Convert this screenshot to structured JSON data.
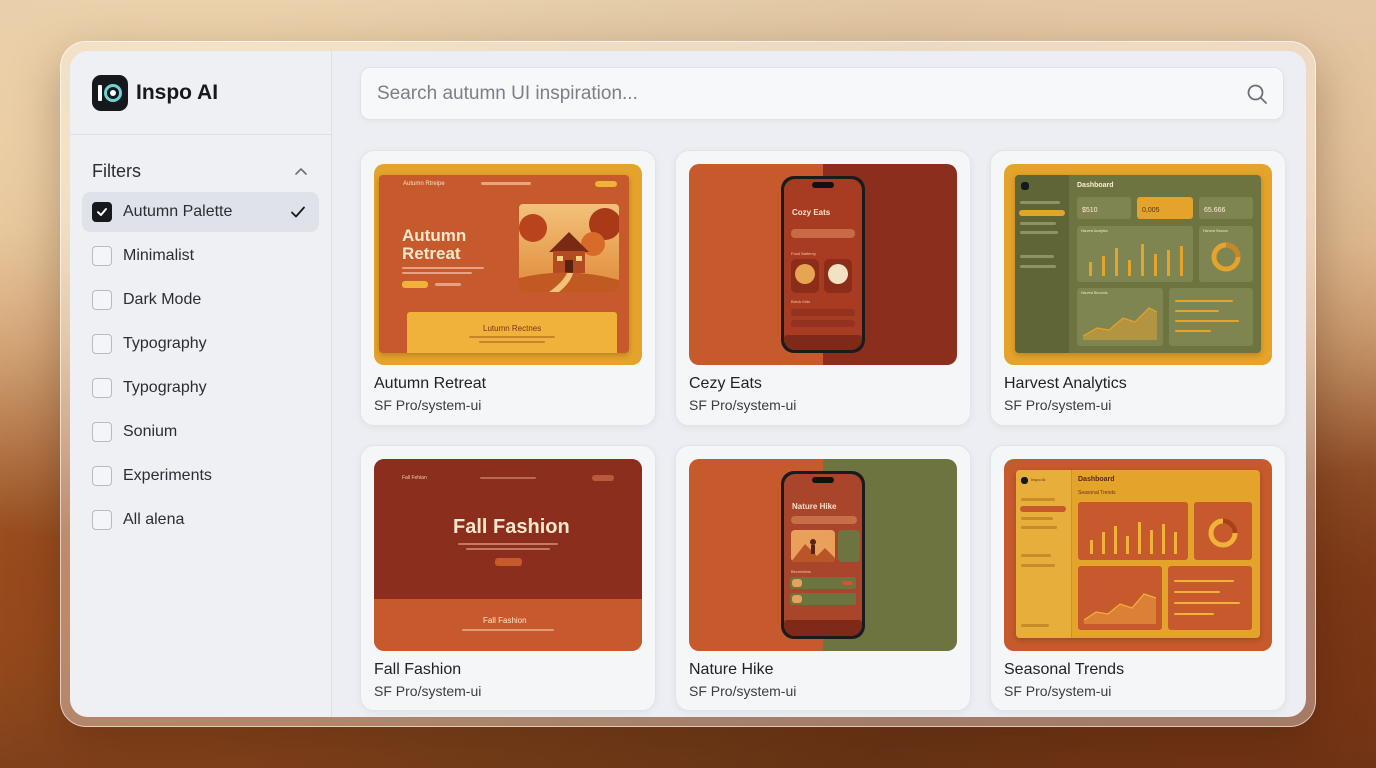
{
  "app": {
    "name": "Inspo AI"
  },
  "sidebar": {
    "filters_title": "Filters",
    "items": [
      {
        "label": "Autumn Palette",
        "checked": true
      },
      {
        "label": "Minimalist",
        "checked": false
      },
      {
        "label": "Dark Mode",
        "checked": false
      },
      {
        "label": "Typography",
        "checked": false
      },
      {
        "label": "Typography",
        "checked": false
      },
      {
        "label": "Sonium",
        "checked": false
      },
      {
        "label": "Experiments",
        "checked": false
      },
      {
        "label": "All alena",
        "checked": false
      }
    ]
  },
  "search": {
    "placeholder": "Search autumn UI inspiration..."
  },
  "cards": [
    {
      "title": "Autumn Retreat",
      "subtitle": "SF Pro/system-ui",
      "preview": {
        "brand": "Autumn Rtreipe",
        "headline_1": "Autumn",
        "headline_2": "Retreat",
        "footer_title": "Lutumn Rectnes"
      }
    },
    {
      "title": "Cezy Eats",
      "subtitle": "SF Pro/system-ui",
      "preview": {
        "app_title": "Cozy Eats",
        "section_1": "Food Balterny",
        "section_2": "Breck Kids"
      }
    },
    {
      "title": "Harvest Analytics",
      "subtitle": "SF Pro/system-ui",
      "preview": {
        "heading": "Dashboard",
        "stat_1": "$510",
        "stat_2": "0,005",
        "stat_3": "65.666",
        "panel_1": "Harvest Analytics",
        "panel_2": "Harvest Bloomds",
        "panel_3": "Harvest Season"
      }
    },
    {
      "title": "Fall Fashion",
      "subtitle": "SF Pro/system-ui",
      "preview": {
        "brand": "Fall Fehian",
        "headline": "Fall Fashion",
        "footer_title": "Fall Fashion"
      }
    },
    {
      "title": "Nature Hike",
      "subtitle": "SF Pro/system-ui",
      "preview": {
        "app_title": "Nature Hike",
        "section": "Becnmbhis"
      }
    },
    {
      "title": "Seasonal Trends",
      "subtitle": "SF Pro/system-ui",
      "preview": {
        "brand": "Inspo AI",
        "heading": "Dashboard",
        "subheading": "Seasonal Trends"
      }
    }
  ],
  "colors": {
    "accent_dark": "#15181d",
    "autumn_orange": "#c65a2c",
    "autumn_rust": "#8c2e1e",
    "autumn_gold": "#e4a32a",
    "autumn_olive": "#6e7440"
  }
}
